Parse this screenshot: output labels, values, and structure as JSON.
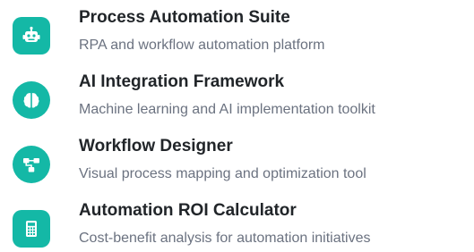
{
  "accent_color": "#14b8a6",
  "items": [
    {
      "icon": "robot-icon",
      "title": "Process Automation Suite",
      "description": "RPA and workflow automation platform"
    },
    {
      "icon": "brain-icon",
      "title": "AI Integration Framework",
      "description": "Machine learning and AI implementation toolkit"
    },
    {
      "icon": "flow-diagram-icon",
      "title": "Workflow Designer",
      "description": "Visual process mapping and optimization tool"
    },
    {
      "icon": "calculator-icon",
      "title": "Automation ROI Calculator",
      "description": "Cost-benefit analysis for automation initiatives"
    }
  ]
}
